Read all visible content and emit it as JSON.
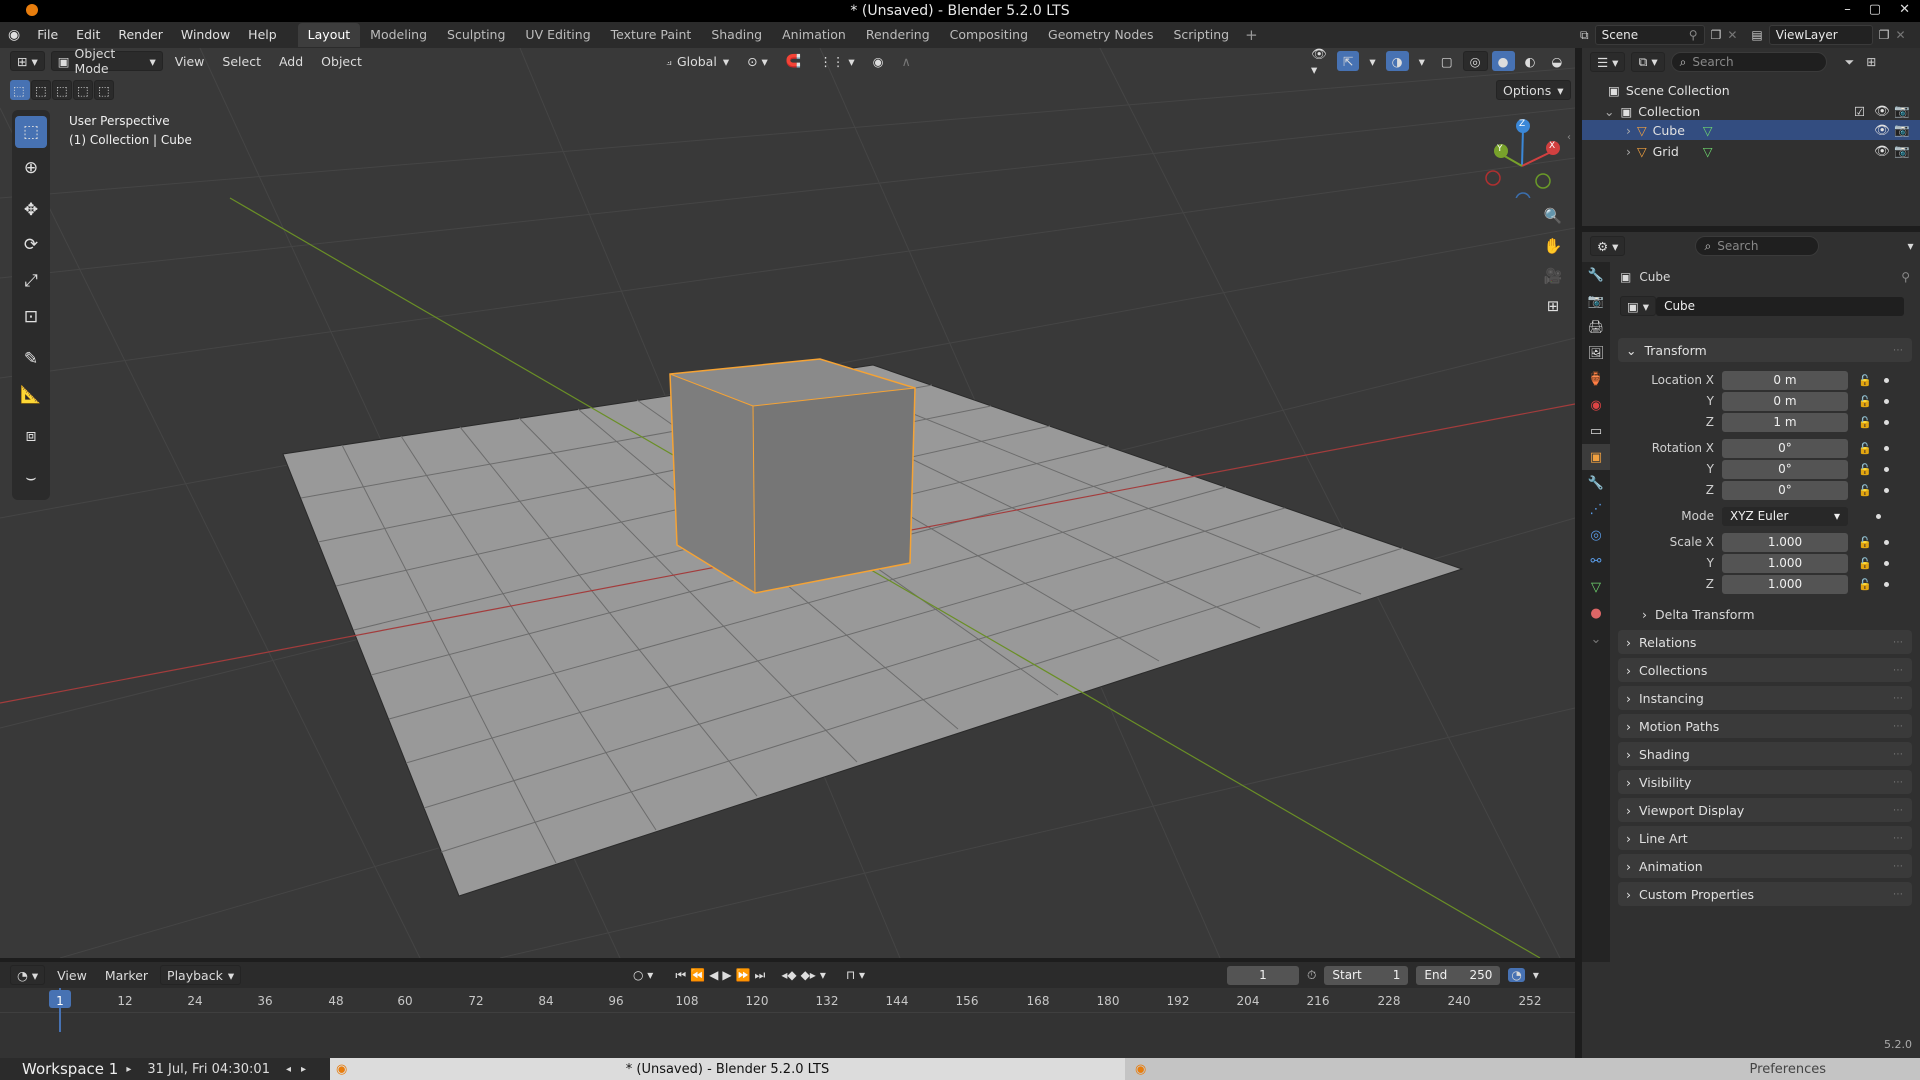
{
  "window": {
    "title": "* (Unsaved) - Blender 5.2.0 LTS"
  },
  "menu": {
    "items": [
      "File",
      "Edit",
      "Render",
      "Window",
      "Help"
    ],
    "workspaces": [
      "Layout",
      "Modeling",
      "Sculpting",
      "UV Editing",
      "Texture Paint",
      "Shading",
      "Animation",
      "Rendering",
      "Compositing",
      "Geometry Nodes",
      "Scripting"
    ],
    "active_workspace": "Layout",
    "scene": "Scene",
    "view_layer": "ViewLayer"
  },
  "viewport": {
    "mode": "Object Mode",
    "header_menus": [
      "View",
      "Select",
      "Add",
      "Object"
    ],
    "orientation": "Global",
    "options_label": "Options",
    "overlay_line1": "User Perspective",
    "overlay_line2": "(1) Collection | Cube",
    "gizmo_axes": {
      "x": "X",
      "y": "Y",
      "z": "Z"
    }
  },
  "timeline": {
    "menus": [
      "View",
      "Marker",
      "Playback"
    ],
    "current_frame": "1",
    "start_label": "Start",
    "start_value": "1",
    "end_label": "End",
    "end_value": "250",
    "ruler_ticks": [
      "1",
      "12",
      "24",
      "36",
      "48",
      "60",
      "72",
      "84",
      "96",
      "108",
      "120",
      "132",
      "144",
      "156",
      "168",
      "180",
      "192",
      "204",
      "216",
      "228",
      "240",
      "252"
    ]
  },
  "outliner": {
    "search_placeholder": "Search",
    "scene_collection": "Scene Collection",
    "collection": "Collection",
    "objects": [
      "Cube",
      "Grid"
    ],
    "selected": "Cube"
  },
  "properties": {
    "search_placeholder": "Search",
    "object_name": "Cube",
    "object_data_name": "Cube",
    "transform_label": "Transform",
    "location_label": "Location X",
    "location": {
      "x": "0 m",
      "y": "0 m",
      "z": "1 m"
    },
    "rotation_label": "Rotation X",
    "rotation": {
      "x": "0°",
      "y": "0°",
      "z": "0°"
    },
    "mode_label": "Mode",
    "mode_value": "XYZ Euler",
    "scale_label": "Scale X",
    "scale": {
      "x": "1.000",
      "y": "1.000",
      "z": "1.000"
    },
    "axis_y": "Y",
    "axis_z": "Z",
    "delta_transform": "Delta Transform",
    "panels": [
      "Relations",
      "Collections",
      "Instancing",
      "Motion Paths",
      "Shading",
      "Visibility",
      "Viewport Display",
      "Line Art",
      "Animation",
      "Custom Properties"
    ],
    "version": "5.2.0"
  },
  "statusbar": {
    "workspace": "Workspace 1",
    "datetime": "31 Jul, Fri 04:30:01",
    "task_title": "* (Unsaved) - Blender 5.2.0 LTS",
    "preferences": "Preferences"
  },
  "colors": {
    "accent": "#4772b3",
    "selection_outline": "#f5a335",
    "x_axis": "#d14040",
    "y_axis": "#78a22b",
    "z_axis": "#3b88d8"
  }
}
